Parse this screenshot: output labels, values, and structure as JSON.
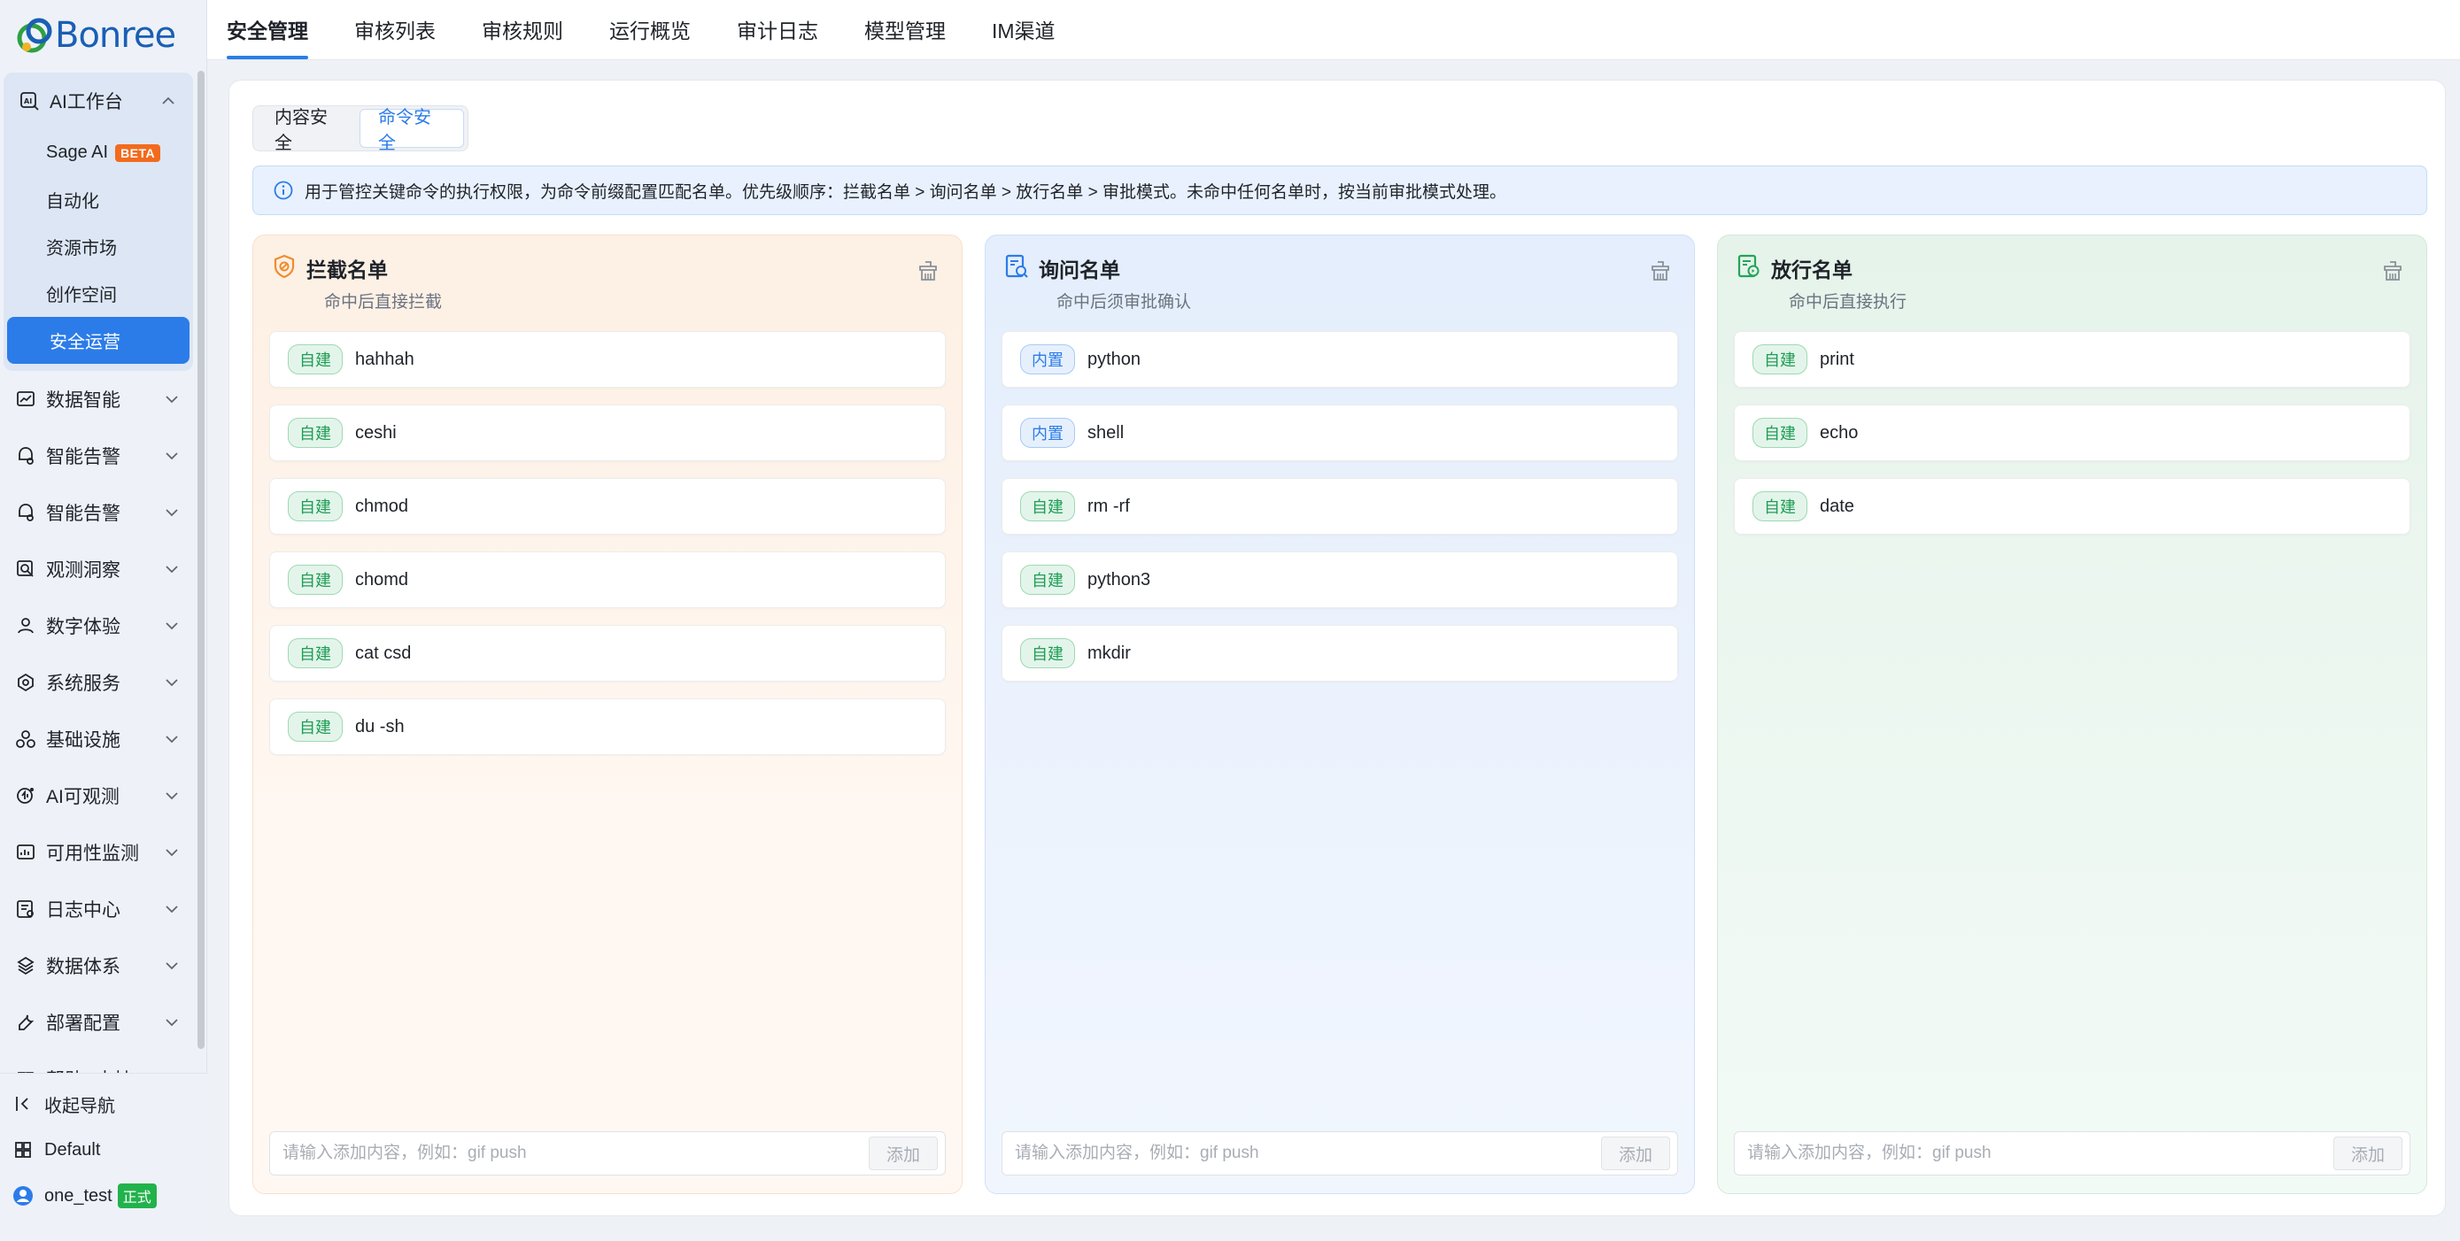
{
  "brand": {
    "name": "Bonree"
  },
  "sidebar": {
    "ai_workbench": {
      "label": "AI工作台",
      "items": [
        {
          "label": "Sage AI",
          "badge": "BETA"
        },
        {
          "label": "自动化"
        },
        {
          "label": "资源市场"
        },
        {
          "label": "创作空间"
        },
        {
          "label": "安全运营",
          "active": true
        }
      ]
    },
    "groups": [
      {
        "label": "数据智能",
        "icon": "chart-icon"
      },
      {
        "label": "智能告警",
        "icon": "alert-icon"
      },
      {
        "label": "智能告警",
        "icon": "alert-icon"
      },
      {
        "label": "观测洞察",
        "icon": "search-doc-icon"
      },
      {
        "label": "数字体验",
        "icon": "user-icon"
      },
      {
        "label": "系统服务",
        "icon": "services-icon"
      },
      {
        "label": "基础设施",
        "icon": "infra-icon"
      },
      {
        "label": "AI可观测",
        "icon": "ai-observe-icon"
      },
      {
        "label": "可用性监测",
        "icon": "monitor-icon"
      },
      {
        "label": "日志中心",
        "icon": "log-icon"
      },
      {
        "label": "数据体系",
        "icon": "data-icon"
      },
      {
        "label": "部署配置",
        "icon": "wrench-icon"
      },
      {
        "label": "帮助&支持",
        "icon": "book-icon"
      }
    ],
    "bottom": {
      "collapse_label": "收起导航",
      "workspace_label": "Default",
      "user_label": "one_test",
      "user_badge": "正式"
    }
  },
  "topbar": {
    "tabs": [
      {
        "label": "安全管理",
        "active": true
      },
      {
        "label": "审核列表"
      },
      {
        "label": "审核规则"
      },
      {
        "label": "运行概览"
      },
      {
        "label": "审计日志"
      },
      {
        "label": "模型管理"
      },
      {
        "label": "IM渠道"
      }
    ]
  },
  "segment": {
    "options": [
      {
        "label": "内容安全"
      },
      {
        "label": "命令安全",
        "active": true
      }
    ]
  },
  "info": {
    "text": "用于管控关键命令的执行权限，为命令前缀配置匹配名单。优先级顺序：拦截名单 > 询问名单 > 放行名单 > 审批模式。未命中任何名单时，按当前审批模式处理。"
  },
  "columns": {
    "block": {
      "title": "拦截名单",
      "subtitle": "命中后直接拦截",
      "accent": "#f08c2b",
      "items": [
        {
          "tag": "自建",
          "cmd": "hahhah"
        },
        {
          "tag": "自建",
          "cmd": "ceshi"
        },
        {
          "tag": "自建",
          "cmd": "chmod"
        },
        {
          "tag": "自建",
          "cmd": "chomd"
        },
        {
          "tag": "自建",
          "cmd": "cat csd"
        },
        {
          "tag": "自建",
          "cmd": "du -sh"
        }
      ],
      "placeholder": "请输入添加内容，例如：gif push",
      "add_label": "添加"
    },
    "ask": {
      "title": "询问名单",
      "subtitle": "命中后须审批确认",
      "accent": "#2b7ce9",
      "items": [
        {
          "tag": "内置",
          "cmd": "python"
        },
        {
          "tag": "内置",
          "cmd": "shell"
        },
        {
          "tag": "自建",
          "cmd": "rm -rf"
        },
        {
          "tag": "自建",
          "cmd": "python3"
        },
        {
          "tag": "自建",
          "cmd": "mkdir"
        }
      ],
      "placeholder": "请输入添加内容，例如：gif push",
      "add_label": "添加"
    },
    "allow": {
      "title": "放行名单",
      "subtitle": "命中后直接执行",
      "accent": "#22a559",
      "items": [
        {
          "tag": "自建",
          "cmd": "print"
        },
        {
          "tag": "自建",
          "cmd": "echo"
        },
        {
          "tag": "自建",
          "cmd": "date"
        }
      ],
      "placeholder": "请输入添加内容，例如：gif push",
      "add_label": "添加"
    }
  },
  "colors": {
    "primary": "#2b7ce9",
    "beta_badge": "#f26b1d",
    "prod_badge": "#22b24c"
  }
}
